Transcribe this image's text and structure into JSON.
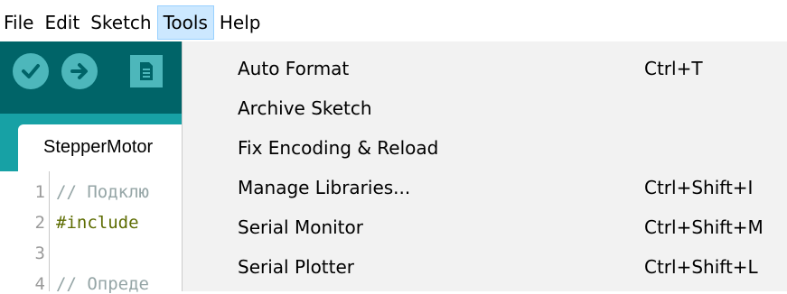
{
  "menubar": {
    "items": [
      {
        "label": "File"
      },
      {
        "label": "Edit"
      },
      {
        "label": "Sketch"
      },
      {
        "label": "Tools",
        "active": true
      },
      {
        "label": "Help"
      }
    ]
  },
  "toolbar": {
    "verify_icon": "checkmark-icon",
    "upload_icon": "arrow-right-icon",
    "new_icon": "document-icon"
  },
  "tabs": [
    {
      "label": "StepperMotor"
    }
  ],
  "editor": {
    "lines": [
      {
        "number": "1",
        "text": "// Подклю",
        "kind": "comment"
      },
      {
        "number": "2",
        "text": "#include ",
        "kind": "preprocessor"
      },
      {
        "number": "3",
        "text": "",
        "kind": "plain"
      },
      {
        "number": "4",
        "text": "// Опреде",
        "kind": "comment"
      }
    ]
  },
  "tools_menu": {
    "items": [
      {
        "label": "Auto Format",
        "shortcut": "Ctrl+T"
      },
      {
        "label": "Archive Sketch",
        "shortcut": ""
      },
      {
        "label": "Fix Encoding & Reload",
        "shortcut": ""
      },
      {
        "label": "Manage Libraries...",
        "shortcut": "Ctrl+Shift+I"
      },
      {
        "label": "Serial Monitor",
        "shortcut": "Ctrl+Shift+M"
      },
      {
        "label": "Serial Plotter",
        "shortcut": "Ctrl+Shift+L"
      }
    ]
  },
  "colors": {
    "ide_dark": "#006468",
    "ide_tabbar": "#17a1a5",
    "toolbar_button": "#4db7bb",
    "menu_active_bg": "#cce8ff",
    "dropdown_bg": "#f2f2f2"
  }
}
